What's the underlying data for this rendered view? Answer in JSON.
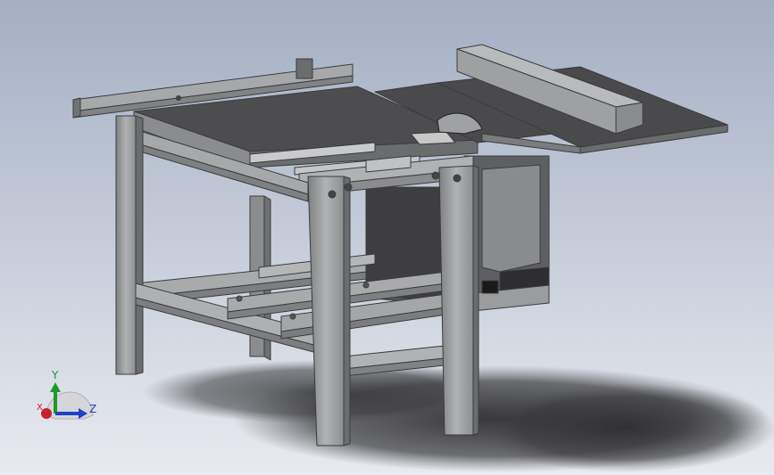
{
  "viewport": {
    "background_top": "#a3afc3",
    "background_bottom": "#e8eaef"
  },
  "triad": {
    "x_label": "X",
    "y_label": "Y",
    "z_label": "Z",
    "x_color": "#c8202a",
    "y_color": "#1a9a2a",
    "z_color": "#2040c8"
  },
  "model": {
    "name": "table-saw",
    "body_color": "#9a9c9e",
    "top_color": "#4a4a4c",
    "shadow_color": "#3a3a3c"
  }
}
